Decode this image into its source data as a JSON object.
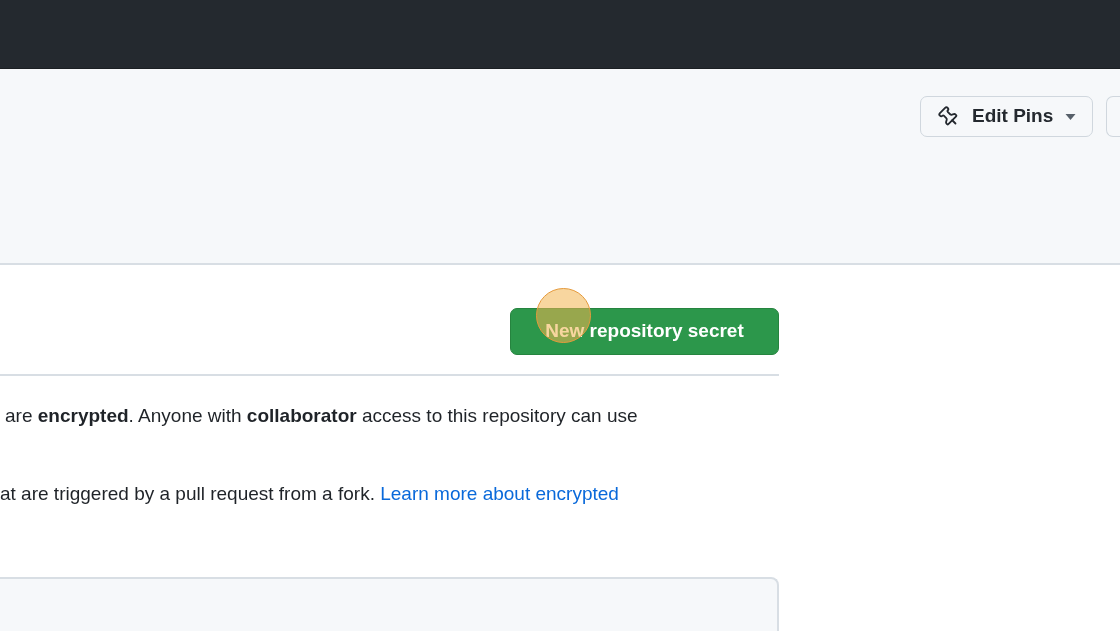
{
  "header": {
    "edit_pins_button": {
      "label": "Edit Pins"
    }
  },
  "secrets_section": {
    "new_secret_button": {
      "label": "New repository secret"
    },
    "paragraphs": [
      {
        "text": "are **encrypted**. Anyone with **collaborator** access to this repository can use"
      },
      {
        "text": "at are triggered by a pull request from a fork.",
        "link": "Learn more about encrypted"
      }
    ]
  }
}
